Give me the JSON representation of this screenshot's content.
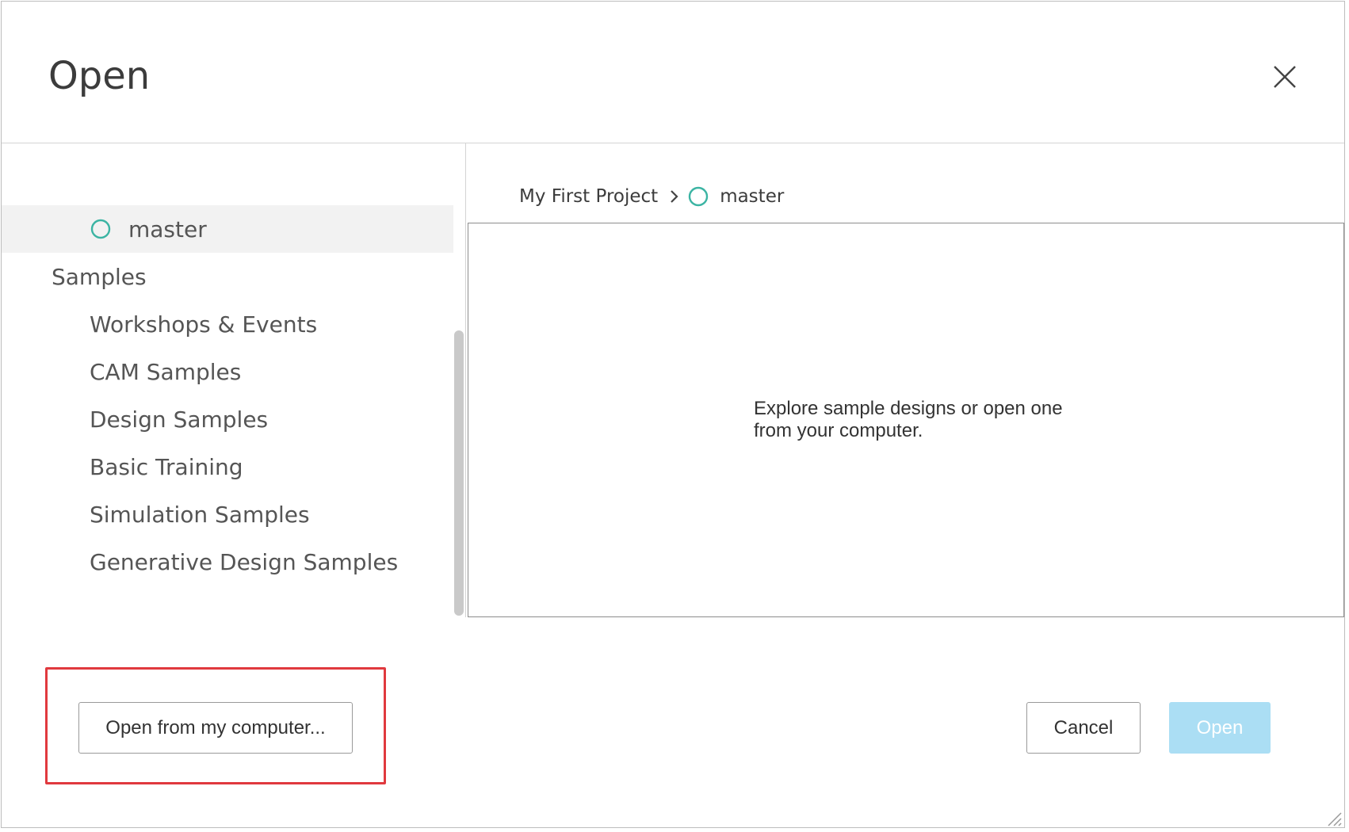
{
  "dialog": {
    "title": "Open"
  },
  "colors": {
    "branch_icon": "#3bb4a3",
    "open_button_disabled": "#abdef4",
    "highlight": "#e0393e"
  },
  "tree": {
    "branch": {
      "label": "master",
      "icon": "branch-circle-icon"
    },
    "group": "Samples",
    "items": [
      {
        "label": "Workshops & Events"
      },
      {
        "label": "CAM Samples"
      },
      {
        "label": "Design Samples"
      },
      {
        "label": "Basic Training"
      },
      {
        "label": "Simulation Samples"
      },
      {
        "label": "Generative Design Samples"
      }
    ]
  },
  "breadcrumb": {
    "project": "My First Project",
    "branch": "master"
  },
  "content": {
    "empty_message": "Explore sample designs or open one from your computer."
  },
  "footer": {
    "open_from_computer": "Open from my computer...",
    "cancel": "Cancel",
    "open": "Open"
  }
}
